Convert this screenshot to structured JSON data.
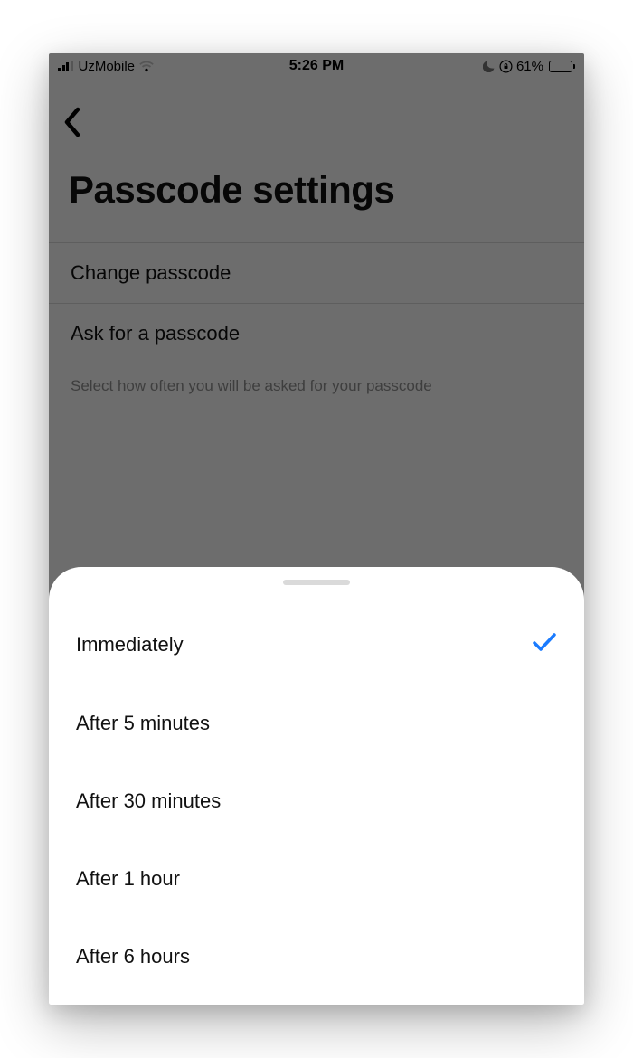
{
  "statusBar": {
    "carrier": "UzMobile",
    "time": "5:26 PM",
    "batteryPercent": "61%"
  },
  "page": {
    "title": "Passcode settings",
    "rows": {
      "change": "Change passcode",
      "ask": "Ask for a passcode"
    },
    "hint": "Select how often you will be asked for your passcode"
  },
  "sheet": {
    "options": [
      {
        "label": "Immediately",
        "selected": true
      },
      {
        "label": "After 5 minutes",
        "selected": false
      },
      {
        "label": "After 30 minutes",
        "selected": false
      },
      {
        "label": "After 1 hour",
        "selected": false
      },
      {
        "label": "After 6 hours",
        "selected": false
      }
    ]
  }
}
